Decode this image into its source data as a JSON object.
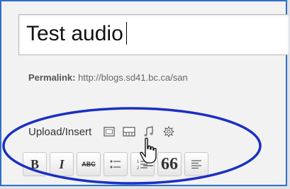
{
  "post": {
    "title_value": "Test audio",
    "permalink_label": "Permalink:",
    "permalink_url": "http://blogs.sd41.bc.ca/san"
  },
  "media": {
    "label": "Upload/Insert",
    "icons": [
      "image-icon",
      "video-icon",
      "audio-icon",
      "media-icon"
    ]
  },
  "toolbar": {
    "bold_label": "B",
    "italic_label": "I",
    "strike_label": "ABC",
    "blockquote_label": "66",
    "buttons": [
      "bold",
      "italic",
      "strikethrough",
      "unordered-list",
      "ordered-list",
      "blockquote",
      "align-left"
    ]
  },
  "colors": {
    "frame_border": "#2f6fc8",
    "highlight_oval": "#1c2fc2",
    "background": "#f2f2f2"
  }
}
